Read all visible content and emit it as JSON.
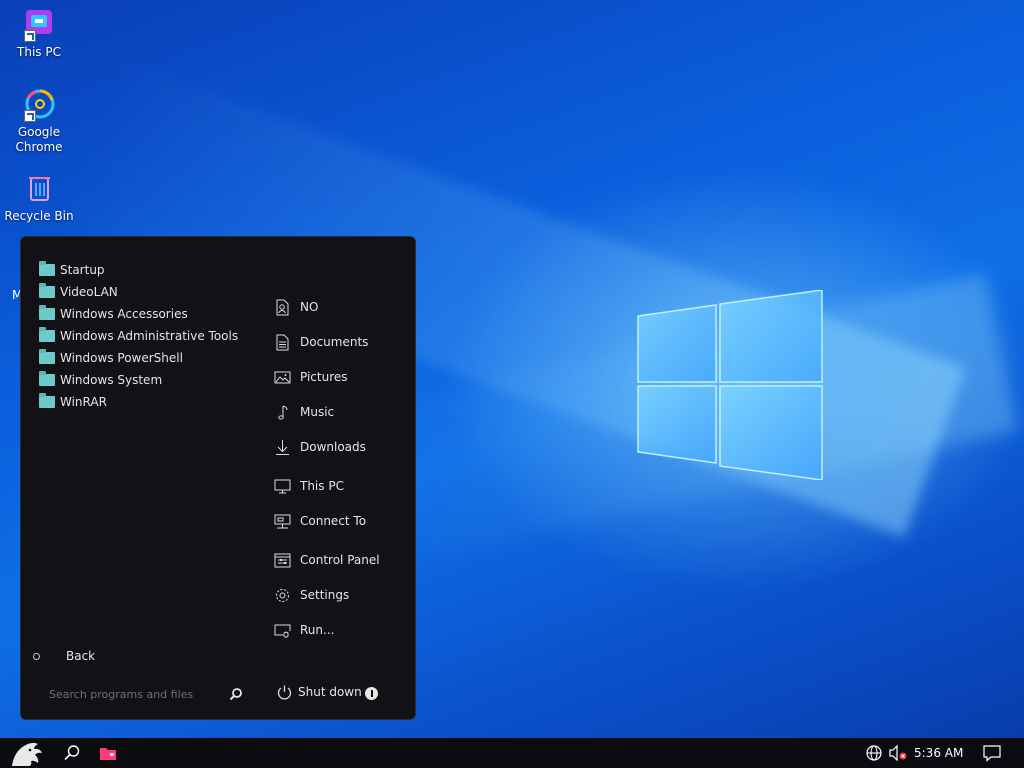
{
  "desktop": {
    "icons": [
      {
        "label": "This PC"
      },
      {
        "label": "Google\nChrome",
        "line1": "Google",
        "line2": "Chrome"
      },
      {
        "label": "Recycle Bin"
      }
    ],
    "partial_label": "M"
  },
  "start_menu": {
    "programs": [
      "Startup",
      "VideoLAN",
      "Windows Accessories",
      "Windows Administrative Tools",
      "Windows PowerShell",
      "Windows System",
      "WinRAR"
    ],
    "places": [
      {
        "label": "NO",
        "icon": "user-icon"
      },
      {
        "label": "Documents",
        "icon": "document-icon"
      },
      {
        "label": "Pictures",
        "icon": "pictures-icon"
      },
      {
        "label": "Music",
        "icon": "music-icon"
      },
      {
        "label": "Downloads",
        "icon": "download-icon"
      },
      {
        "label": "This PC",
        "icon": "computer-icon"
      },
      {
        "label": "Connect To",
        "icon": "connect-icon"
      },
      {
        "label": "Control Panel",
        "icon": "control-panel-icon"
      },
      {
        "label": "Settings",
        "icon": "gear-icon"
      },
      {
        "label": "Run...",
        "icon": "run-icon"
      }
    ],
    "back_label": "Back",
    "search_placeholder": "Search programs and files",
    "shutdown_label": "Shut down"
  },
  "taskbar": {
    "time": "5:36 AM"
  },
  "colors": {
    "menu_bg": "#111116",
    "folder": "#6ec9c9",
    "taskbar_bg": "#0c0c10"
  }
}
